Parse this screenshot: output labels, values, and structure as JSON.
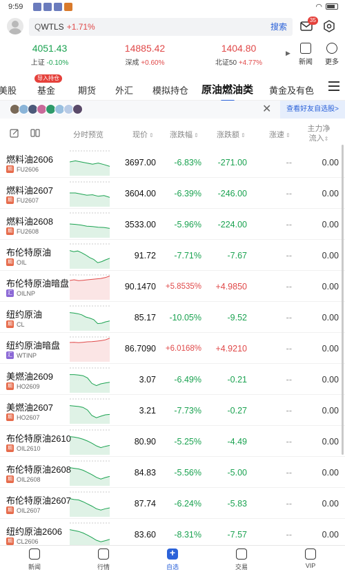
{
  "status_bar": {
    "time": "9:59"
  },
  "search": {
    "symbol": "WTLS",
    "change": "+1.71%",
    "button": "搜索",
    "badge": "35"
  },
  "indices": [
    {
      "value": "4051.43",
      "name": "上证",
      "change": "-0.10%",
      "dir": "down"
    },
    {
      "value": "14885.42",
      "name": "深成",
      "change": "+0.60%",
      "dir": "up"
    },
    {
      "value": "1404.80",
      "name": "北证50",
      "change": "+4.77%",
      "dir": "up"
    }
  ],
  "top_buttons": {
    "news": "新闻",
    "more": "更多"
  },
  "tabs": [
    "美股",
    "基金",
    "期货",
    "外汇",
    "模拟持仓",
    "原油燃油类",
    "黄金及有色"
  ],
  "tab_tag": "导入持仓",
  "active_tab": "原油燃油类",
  "friends": {
    "button": "查看好友自选股>"
  },
  "table_header": {
    "trend": "分时预览",
    "price": "现价",
    "pct": "涨跌幅",
    "amt": "涨跌额",
    "speed": "涨速",
    "flow_l1": "主力净",
    "flow_l2": "流入"
  },
  "rows": [
    {
      "name": "燃料油2606",
      "tag": "期",
      "code": "FU2606",
      "price": "3697.00",
      "pct": "-6.83%",
      "amt": "-271.00",
      "speed": "--",
      "flow": "0.00",
      "dir": "down",
      "trend": [
        0.5,
        0.45,
        0.5,
        0.55,
        0.6,
        0.55,
        0.62,
        0.7
      ]
    },
    {
      "name": "燃料油2607",
      "tag": "期",
      "code": "FU2607",
      "price": "3604.00",
      "pct": "-6.39%",
      "amt": "-246.00",
      "speed": "--",
      "flow": "0.00",
      "dir": "down",
      "trend": [
        0.5,
        0.5,
        0.55,
        0.6,
        0.58,
        0.65,
        0.62,
        0.7
      ]
    },
    {
      "name": "燃料油2608",
      "tag": "期",
      "code": "FU2608",
      "price": "3533.00",
      "pct": "-5.96%",
      "amt": "-224.00",
      "speed": "--",
      "flow": "0.00",
      "dir": "down",
      "trend": [
        0.5,
        0.52,
        0.55,
        0.6,
        0.62,
        0.65,
        0.66,
        0.7
      ]
    },
    {
      "name": "布伦特原油",
      "tag": "期",
      "code": "OIL",
      "price": "91.72",
      "pct": "-7.71%",
      "amt": "-7.67",
      "speed": "--",
      "flow": "0.00",
      "dir": "down",
      "trend": [
        0.3,
        0.35,
        0.32,
        0.4,
        0.5,
        0.62,
        0.7,
        0.85,
        0.8,
        0.72,
        0.65
      ]
    },
    {
      "name": "布伦特原油暗盘",
      "tag": "汇",
      "code": "OILNP",
      "price": "90.1470",
      "pct": "+5.8535%",
      "amt": "+4.9850",
      "speed": "--",
      "flow": "0.00",
      "dir": "up",
      "trend": [
        0.25,
        0.22,
        0.26,
        0.24,
        0.22,
        0.2,
        0.18,
        0.16,
        0.12,
        0.05
      ]
    },
    {
      "name": "纽约原油",
      "tag": "期",
      "code": "CL",
      "price": "85.17",
      "pct": "-10.05%",
      "amt": "-9.52",
      "speed": "--",
      "flow": "0.00",
      "dir": "down",
      "trend": [
        0.3,
        0.32,
        0.35,
        0.4,
        0.5,
        0.55,
        0.62,
        0.8,
        0.78,
        0.72,
        0.68
      ]
    },
    {
      "name": "纽约原油暗盘",
      "tag": "汇",
      "code": "WTINP",
      "price": "86.7090",
      "pct": "+6.0168%",
      "amt": "+4.9210",
      "speed": "--",
      "flow": "0.00",
      "dir": "up",
      "trend": [
        0.25,
        0.24,
        0.26,
        0.24,
        0.22,
        0.21,
        0.19,
        0.17,
        0.13,
        0.06
      ]
    },
    {
      "name": "美燃油2609",
      "tag": "期",
      "code": "HO2609",
      "price": "3.07",
      "pct": "-6.49%",
      "amt": "-0.21",
      "speed": "--",
      "flow": "0.00",
      "dir": "down",
      "trend": [
        0.3,
        0.3,
        0.32,
        0.35,
        0.45,
        0.7,
        0.8,
        0.72,
        0.68,
        0.65
      ]
    },
    {
      "name": "美燃油2607",
      "tag": "期",
      "code": "HO2607",
      "price": "3.21",
      "pct": "-7.73%",
      "amt": "-0.27",
      "speed": "--",
      "flow": "0.00",
      "dir": "down",
      "trend": [
        0.3,
        0.32,
        0.34,
        0.38,
        0.5,
        0.75,
        0.85,
        0.78,
        0.72,
        0.7
      ]
    },
    {
      "name": "布伦特原油2610",
      "tag": "期",
      "code": "OIL2610",
      "price": "80.90",
      "pct": "-5.25%",
      "amt": "-4.49",
      "speed": "--",
      "flow": "0.00",
      "dir": "down",
      "trend": [
        0.3,
        0.32,
        0.36,
        0.42,
        0.5,
        0.6,
        0.72,
        0.8,
        0.74,
        0.7
      ]
    },
    {
      "name": "布伦特原油2608",
      "tag": "期",
      "code": "OIL2608",
      "price": "84.83",
      "pct": "-5.56%",
      "amt": "-5.00",
      "speed": "--",
      "flow": "0.00",
      "dir": "down",
      "trend": [
        0.3,
        0.33,
        0.36,
        0.42,
        0.52,
        0.62,
        0.74,
        0.82,
        0.75,
        0.7
      ]
    },
    {
      "name": "布伦特原油2607",
      "tag": "期",
      "code": "OIL2607",
      "price": "87.74",
      "pct": "-6.24%",
      "amt": "-5.83",
      "speed": "--",
      "flow": "0.00",
      "dir": "down",
      "trend": [
        0.3,
        0.34,
        0.36,
        0.44,
        0.54,
        0.64,
        0.76,
        0.82,
        0.76,
        0.72
      ]
    },
    {
      "name": "纽约原油2606",
      "tag": "期",
      "code": "CL2606",
      "price": "83.60",
      "pct": "-8.31%",
      "amt": "-7.57",
      "speed": "--",
      "flow": "0.00",
      "dir": "down",
      "trend": [
        0.3,
        0.34,
        0.38,
        0.45,
        0.55,
        0.66,
        0.78,
        0.85,
        0.8,
        0.74
      ]
    }
  ],
  "bottom_nav": [
    "新闻",
    "行情",
    "自选",
    "交易",
    "VIP"
  ],
  "colors": {
    "up": "#e04848",
    "down": "#1aa250",
    "accent": "#2b62d9"
  }
}
